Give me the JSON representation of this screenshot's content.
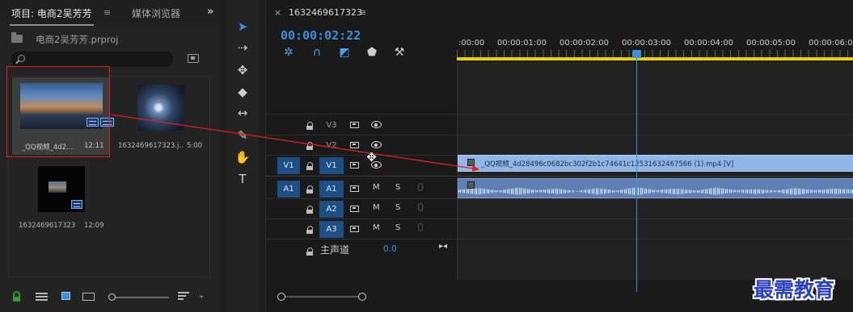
{
  "project_panel": {
    "tab_project": "项目: 电商2吴芳芳",
    "tab_media_browser": "媒体浏览器",
    "project_file": "电商2吴芳芳.prproj",
    "search_placeholder": "",
    "items": [
      {
        "name": "_QQ视频_4d2...",
        "duration": "12:11"
      },
      {
        "name": "1632469617323.j...",
        "duration": "5:00"
      },
      {
        "name": "1632469617323",
        "duration": "12:09"
      }
    ]
  },
  "timeline": {
    "sequence_name": "1632469617323",
    "timecode": "00:00:02:22",
    "ruler_labels": [
      ":00:00",
      "00:00:01:00",
      "00:00:02:00",
      "00:00:03:00",
      "00:00:04:00",
      "00:00:05:00",
      "00:00:06:00"
    ],
    "video_tracks": [
      {
        "label": "V3",
        "source": ""
      },
      {
        "label": "V2",
        "source": ""
      },
      {
        "label": "V1",
        "source": "V1"
      }
    ],
    "audio_tracks": [
      {
        "label": "A1",
        "source": "A1",
        "mute": "M",
        "solo": "S"
      },
      {
        "label": "A2",
        "source": "",
        "mute": "M",
        "solo": "S"
      },
      {
        "label": "A3",
        "source": "",
        "mute": "M",
        "solo": "S"
      }
    ],
    "master_label": "主声道",
    "master_value": "0.0",
    "video_clip_label": "_QQ视频_4d28496c0682bc302f2b1c74641c12531632467566 (1).mp4 [V]",
    "playhead_progress": 0.47
  },
  "watermark": "最需教育",
  "colors": {
    "accent": "#3d8fdc",
    "work_area": "#e6d200",
    "video_clip": "#8fb6e6",
    "audio_clip": "#5d7fb3",
    "annotation": "#e02020"
  }
}
